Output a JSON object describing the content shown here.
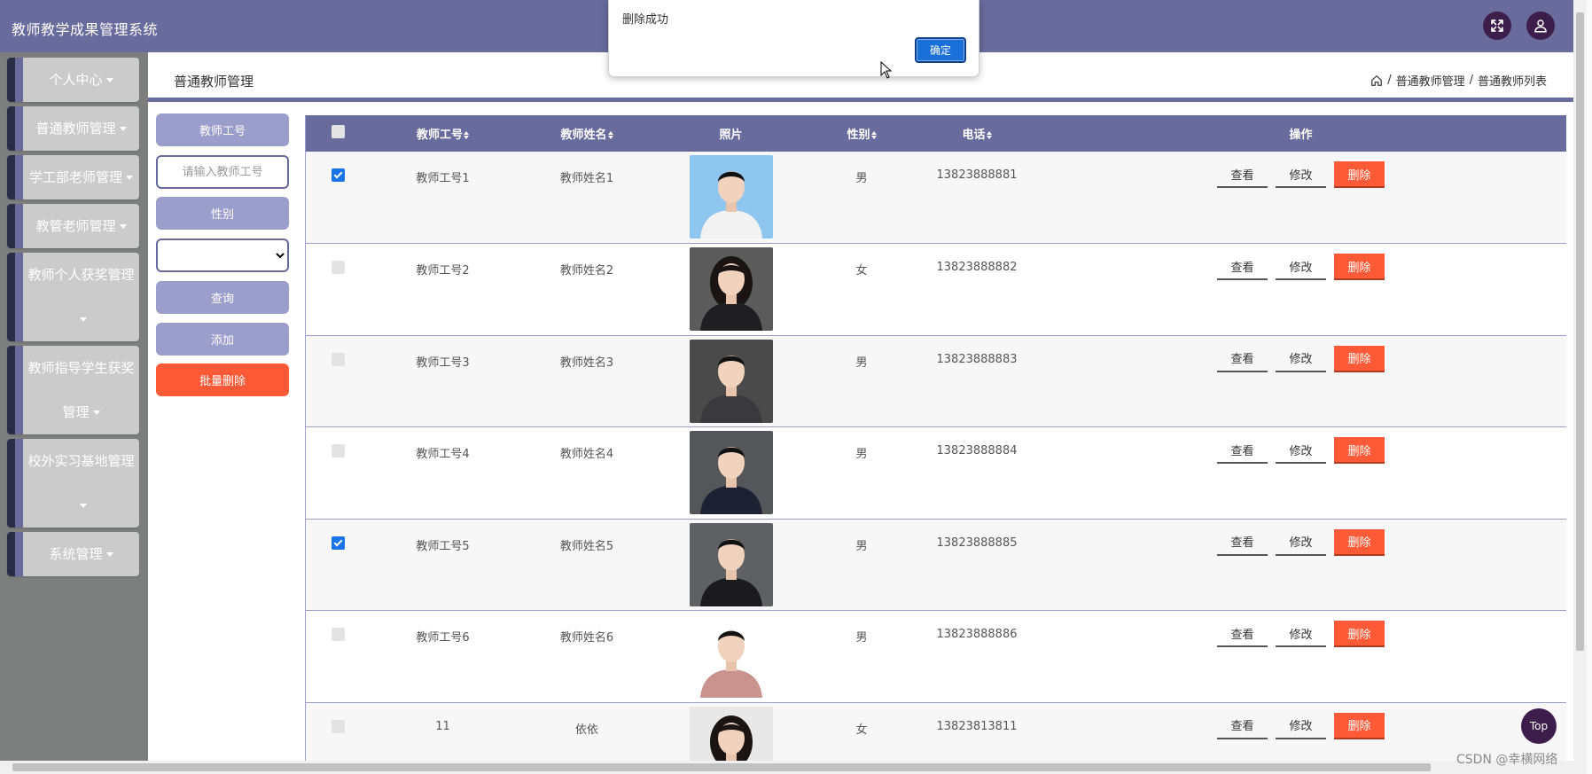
{
  "header": {
    "title": "教师教学成果管理系统",
    "icons": [
      "fullscreen-icon",
      "user-icon"
    ]
  },
  "sidebar": {
    "items": [
      {
        "label": "个人中心"
      },
      {
        "label": "普通教师管理"
      },
      {
        "label": "学工部老师管理"
      },
      {
        "label": "教管老师管理"
      },
      {
        "label": "教师个人获奖管理"
      },
      {
        "label": "教师指导学生获奖管理"
      },
      {
        "label": "校外实习基地管理"
      },
      {
        "label": "系统管理"
      }
    ]
  },
  "content": {
    "title": "普通教师管理",
    "breadcrumb": [
      "普通教师管理",
      "普通教师列表"
    ],
    "breadcrumb_sep": "/"
  },
  "search": {
    "id_label": "教师工号",
    "id_placeholder": "请输入教师工号",
    "gender_label": "性别",
    "gender_selected": "",
    "query_label": "查询",
    "add_label": "添加",
    "batch_delete_label": "批量删除"
  },
  "table": {
    "columns": [
      "教师工号",
      "教师姓名",
      "照片",
      "性别",
      "电话",
      "操作"
    ],
    "rows": [
      {
        "id": "教师工号1",
        "name": "教师姓名1",
        "gender": "男",
        "phone": "13823888881",
        "checked": true
      },
      {
        "id": "教师工号2",
        "name": "教师姓名2",
        "gender": "女",
        "phone": "13823888882",
        "checked": false
      },
      {
        "id": "教师工号3",
        "name": "教师姓名3",
        "gender": "男",
        "phone": "13823888883",
        "checked": false
      },
      {
        "id": "教师工号4",
        "name": "教师姓名4",
        "gender": "男",
        "phone": "13823888884",
        "checked": false
      },
      {
        "id": "教师工号5",
        "name": "教师姓名5",
        "gender": "男",
        "phone": "13823888885",
        "checked": true
      },
      {
        "id": "教师工号6",
        "name": "教师姓名6",
        "gender": "男",
        "phone": "13823888886",
        "checked": false
      },
      {
        "id": "11",
        "name": "依依",
        "gender": "女",
        "phone": "13823813811",
        "checked": false
      }
    ],
    "actions": {
      "view": "查看",
      "edit": "修改",
      "delete": "删除"
    }
  },
  "dialog": {
    "message": "删除成功",
    "ok_label": "确定"
  },
  "misc": {
    "top_label": "Top",
    "watermark": "CSDN @幸横网络"
  },
  "colors": {
    "primary": "#686b9b",
    "primary_light": "#9b9dcb",
    "danger": "#ff5a37",
    "dark": "#3d1e4a",
    "sidebar_bg": "#7d7f7f",
    "sidebar_item": "#cbcbcb"
  }
}
